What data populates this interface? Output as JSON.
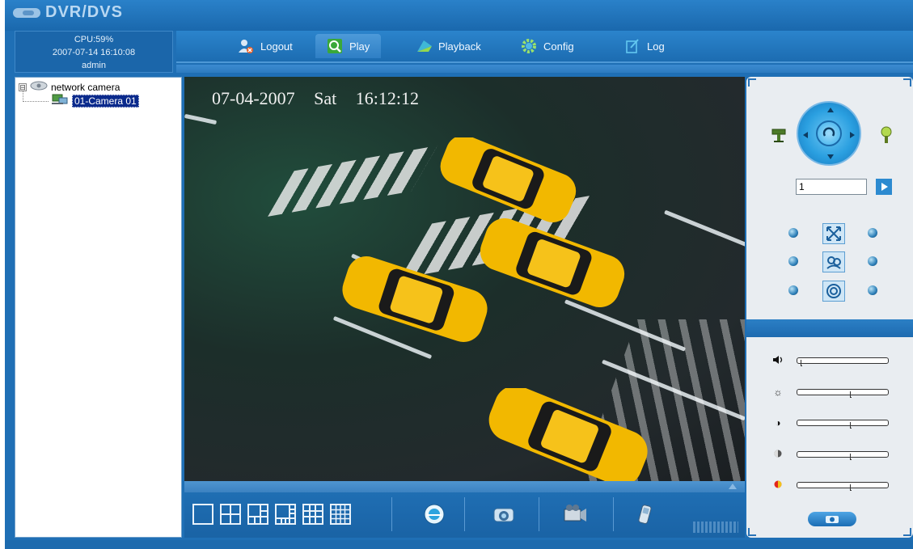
{
  "app": {
    "title": "DVR/DVS"
  },
  "status": {
    "cpu": "CPU:59%",
    "datetime": "2007-07-14 16:10:08",
    "user": "admin"
  },
  "nav": {
    "tabs": [
      {
        "label": "Logout",
        "icon": "logout-user-icon"
      },
      {
        "label": "Play",
        "icon": "play-magnifier-icon",
        "active": true
      },
      {
        "label": "Playback",
        "icon": "playback-icon"
      },
      {
        "label": "Config",
        "icon": "gear-icon"
      },
      {
        "label": "Log",
        "icon": "log-document-icon"
      }
    ]
  },
  "tree": {
    "root": {
      "label": "network camera",
      "expander": "⊟"
    },
    "children": [
      {
        "label": "01-Camera 01",
        "selected": true
      }
    ]
  },
  "video": {
    "osd_date": "07-04-2007",
    "osd_day": "Sat",
    "osd_time": "16:12:12"
  },
  "toolbar": {
    "layouts": [
      "1x1",
      "2x2",
      "1+5",
      "1+7",
      "3x3",
      "4x4"
    ],
    "tools": [
      "snapshot-icon",
      "record-camera-icon",
      "video-camera-icon",
      "talk-mobile-icon"
    ]
  },
  "ptz": {
    "preset_value": "1",
    "left_icon": "ptz-mount-icon",
    "right_icon": "light-bulb-icon",
    "center_icon": "auto-rotate-icon",
    "buttons": [
      "zoom-icon",
      "focus-icon",
      "iris-icon"
    ]
  },
  "image": {
    "sliders": [
      {
        "name": "volume",
        "icon": "speaker-icon",
        "level": 0.0
      },
      {
        "name": "brightness",
        "icon": "sun-icon",
        "level": 0.55
      },
      {
        "name": "contrast",
        "icon": "contrast-icon",
        "level": 0.55
      },
      {
        "name": "saturation",
        "icon": "saturation-icon",
        "level": 0.55
      },
      {
        "name": "hue",
        "icon": "hue-icon",
        "level": 0.55
      }
    ]
  },
  "colors": {
    "accent": "#1f6fb5",
    "selection": "#0a2a8c",
    "panel": "#e9edf1",
    "taxi": "#f2b800"
  }
}
